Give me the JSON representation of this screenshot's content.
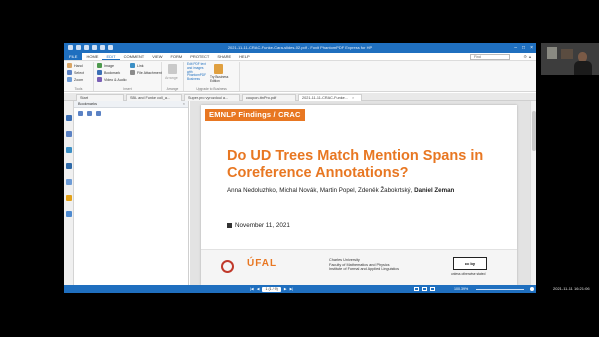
{
  "window": {
    "title": "2021-11-11-CRAC-Funke-Cara-slides-02.pdf - Foxit PhantomPDF Express for HP",
    "controls": [
      "–",
      "□",
      "×"
    ]
  },
  "menu": {
    "file": "FILE",
    "items": [
      "HOME",
      "EDIT",
      "COMMENT",
      "VIEW",
      "FORM",
      "PROTECT",
      "SHARE",
      "HELP"
    ],
    "active": "EDIT",
    "search_placeholder": "Find"
  },
  "ribbon": {
    "tools": {
      "label": "Tools",
      "items": [
        "Hand",
        "Select",
        "Zoom"
      ]
    },
    "insert": {
      "label": "Insert",
      "items": [
        "Image",
        "Bookmark",
        "Video & Audio",
        "Link",
        "File Attachment"
      ]
    },
    "arrange": {
      "label": "Arrange",
      "item": "Arrange"
    },
    "upgrade": {
      "label": "Upgrade to Business",
      "promo": "Edit PDF text and images with PhantomPDF Business",
      "button": "Try Business Edition"
    }
  },
  "tabs": [
    {
      "label": "Start",
      "active": false
    },
    {
      "label": "SBL and Funke coll_a...",
      "active": false
    },
    {
      "label": "Super.pro vyrozdoul a...",
      "active": false
    },
    {
      "label": "coupon-ttnPro.pdf",
      "active": false
    },
    {
      "label": "2021-11-11-CRAC-Funke...",
      "active": true
    }
  ],
  "bookmarks": {
    "title": "Bookmarks",
    "close": "×"
  },
  "slide": {
    "venue": "EMNLP Findings / CRAC",
    "title": "Do UD Trees Match Mention Spans in Coreference Annotations?",
    "authors": "Anna Nedoluzhko, Michal Novák, Martin Popel, Zdeněk Žabokrtský,",
    "author_bold": "Daniel Zeman",
    "date": "November 11, 2021",
    "footer": {
      "logo_text": "ÚFAL",
      "university": "Charles University",
      "faculty": "Faculty of Mathematics and Physics",
      "institute": "Institute of Formal and Applied Linguistics",
      "license": "cc by",
      "license_note": "unless otherwise stated"
    }
  },
  "status": {
    "page": "1 (1 / 9)",
    "zoom": "100.39%",
    "nav_first": "|◀",
    "nav_prev": "◀",
    "nav_next": "▶",
    "nav_last": "▶|"
  },
  "clock": "2021-11-11  16:21:06",
  "colors": {
    "accent_blue": "#1f6fbf",
    "slide_orange": "#e87722"
  }
}
